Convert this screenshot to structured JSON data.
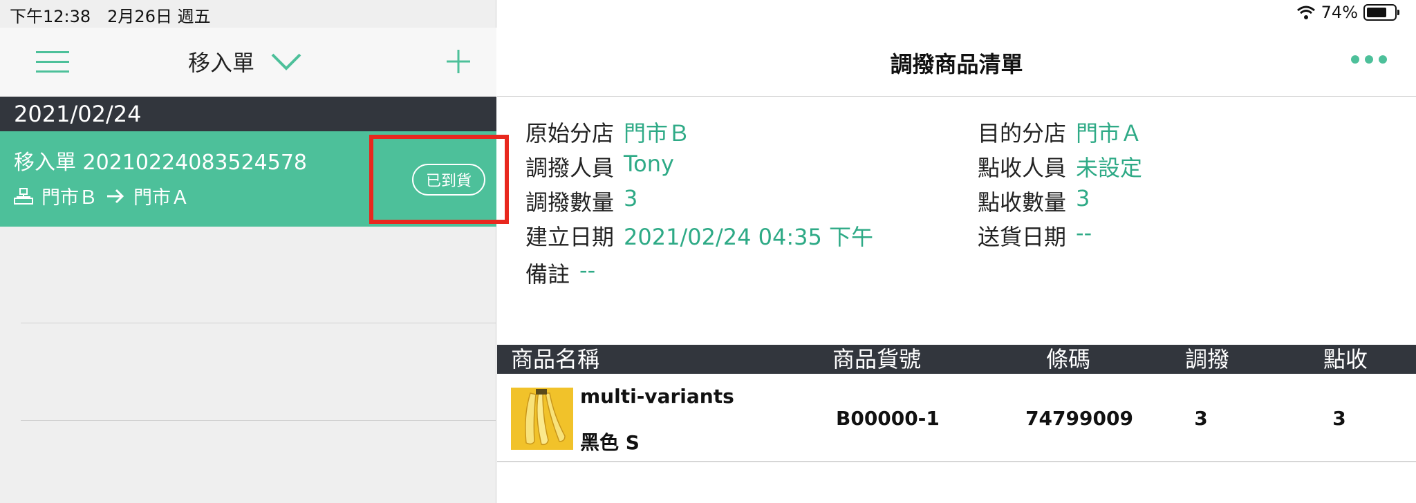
{
  "status_bar": {
    "time_date": "下午12:38　2月26日 週五",
    "battery_pct": "74%",
    "battery_level": 0.74,
    "icons": [
      "wifi-icon",
      "battery-icon"
    ]
  },
  "left_pane": {
    "title": "移入單",
    "date_header": "2021/02/24",
    "order": {
      "title": "移入單  20210224083524578",
      "from_store": "門市Ｂ",
      "to_store": "門市Ａ",
      "status_badge": "已到貨"
    }
  },
  "right_pane": {
    "title": "調撥商品清單",
    "info_left": [
      {
        "label": "原始分店",
        "value": "門市Ｂ"
      },
      {
        "label": "調撥人員",
        "value": "Tony"
      },
      {
        "label": "調撥數量",
        "value": "3"
      },
      {
        "label": "建立日期",
        "value": "2021/02/24 04:35 下午"
      },
      {
        "label": "備註",
        "value": "--"
      }
    ],
    "info_right": [
      {
        "label": "目的分店",
        "value": "門市Ａ"
      },
      {
        "label": "點收人員",
        "value": "未設定"
      },
      {
        "label": "點收數量",
        "value": "3"
      },
      {
        "label": "送貨日期",
        "value": "--"
      }
    ],
    "table": {
      "headers": [
        "商品名稱",
        "商品貨號",
        "條碼",
        "調撥",
        "點收"
      ],
      "rows": [
        {
          "name": "multi-variants",
          "variant": "黑色 S",
          "sku": "B00000-1",
          "barcode": "74799009",
          "transfer": "3",
          "received": "3"
        }
      ]
    }
  },
  "colors": {
    "accent": "#4dc09a",
    "value_text": "#2eaa86",
    "dark_header": "#32363d",
    "highlight": "#e8281e"
  }
}
